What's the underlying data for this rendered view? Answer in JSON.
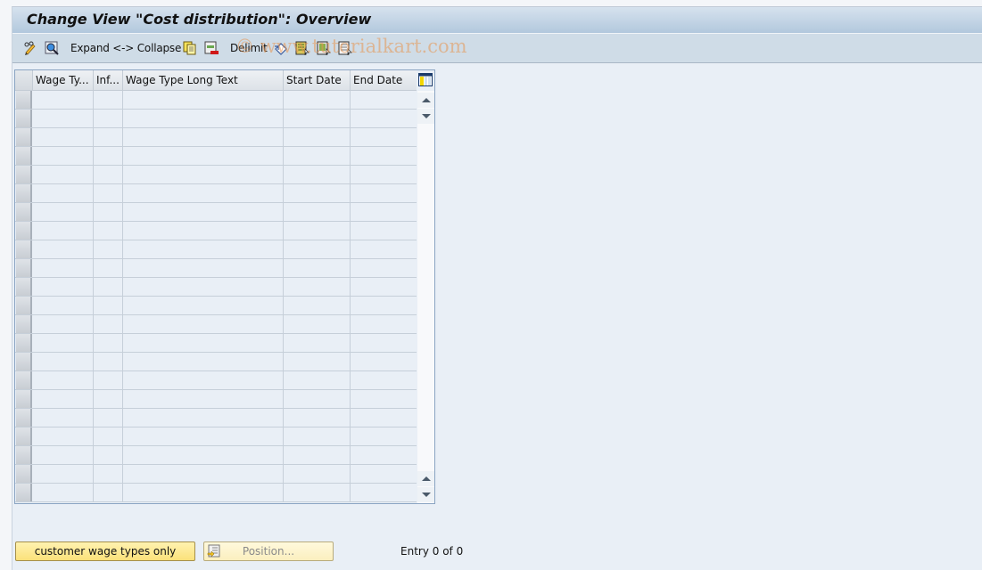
{
  "window": {
    "title": "Change View \"Cost distribution\": Overview"
  },
  "toolbar": {
    "items": [
      {
        "icon": "change-display-icon"
      },
      {
        "icon": "find-icon"
      },
      {
        "label": "Expand <-> Collapse"
      },
      {
        "icon": "copy-icon"
      },
      {
        "icon": "delete-icon"
      },
      {
        "label": "Delimit"
      },
      {
        "icon": "undo-change-icon"
      },
      {
        "icon": "select-all-icon"
      },
      {
        "icon": "select-block-icon"
      },
      {
        "icon": "deselect-all-icon"
      }
    ],
    "expand_collapse_label": "Expand <-> Collapse",
    "delimit_label": "Delimit",
    "watermark": "© www.tutorialkart.com"
  },
  "table": {
    "columns": [
      {
        "label": "Wage Ty..."
      },
      {
        "label": "Inf..."
      },
      {
        "label": "Wage Type Long Text"
      },
      {
        "label": "Start Date"
      },
      {
        "label": "End Date"
      }
    ],
    "row_count": 22,
    "rows": []
  },
  "footer": {
    "customer_button": "customer wage types only",
    "position_button": "Position...",
    "entry_status": "Entry 0 of 0"
  }
}
